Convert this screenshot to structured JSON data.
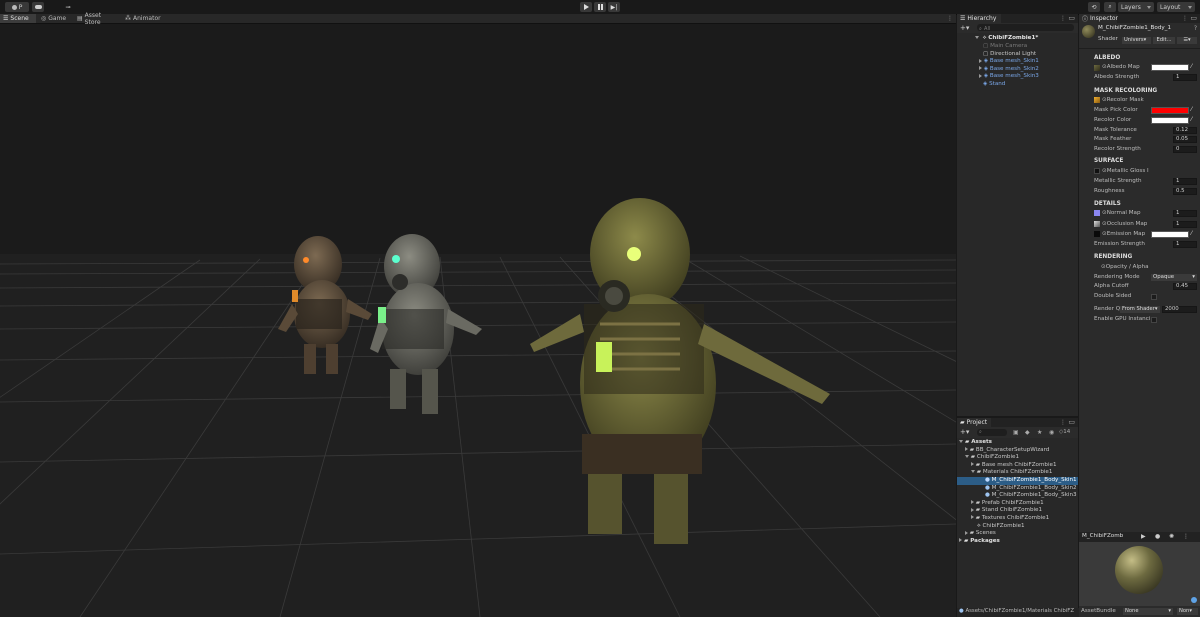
{
  "toolbar": {
    "account_label": "P",
    "layers_label": "Layers",
    "layout_label": "Layout"
  },
  "scene_tabs": [
    "Scene",
    "Game",
    "Asset Store",
    "Animator"
  ],
  "hierarchy": {
    "title": "Hierarchy",
    "search_placeholder": "All",
    "scene_name": "ChibiFZombie1*",
    "items": [
      {
        "label": "Main Camera",
        "style": "grey"
      },
      {
        "label": "Directional Light",
        "style": "normal"
      },
      {
        "label": "Base mesh_Skin1",
        "style": "blue"
      },
      {
        "label": "Base mesh_Skin2",
        "style": "blue"
      },
      {
        "label": "Base mesh_Skin3",
        "style": "blue"
      },
      {
        "label": "Stand",
        "style": "blue"
      }
    ]
  },
  "project": {
    "title": "Project",
    "count_badge": "14",
    "tree": [
      {
        "label": "Assets",
        "indent": 0
      },
      {
        "label": "BB_CharacterSetupWizard",
        "indent": 1
      },
      {
        "label": "ChibiFZombie1",
        "indent": 1
      },
      {
        "label": "Base mesh ChibiFZombie1",
        "indent": 2
      },
      {
        "label": "Materials ChibiFZombie1",
        "indent": 2
      },
      {
        "label": "M_ChibiFZombie1_Body_Skin1",
        "indent": 3,
        "selected": true
      },
      {
        "label": "M_ChibiFZombie1_Body_Skin2",
        "indent": 3
      },
      {
        "label": "M_ChibiFZombie1_Body_Skin3",
        "indent": 3
      },
      {
        "label": "Prefab ChibiFZombie1",
        "indent": 2
      },
      {
        "label": "Stand ChibiFZombie1",
        "indent": 2
      },
      {
        "label": "Textures ChibiFZombie1",
        "indent": 2
      },
      {
        "label": "ChibiFZombie1",
        "indent": 2
      },
      {
        "label": "Scenes",
        "indent": 1
      },
      {
        "label": "Packages",
        "indent": 0
      }
    ],
    "path": "Assets/ChibiFZombie1/Materials ChibiFZ"
  },
  "inspector": {
    "title": "Inspector",
    "material_name": "M_ChibiFZombie1_Body_1",
    "shader_label": "Shader",
    "shader_value": "Univers",
    "edit_label": "Edit...",
    "sections": {
      "albedo": "ALBEDO",
      "mask": "MASK RECOLORING",
      "surface": "SURFACE",
      "details": "DETAILS",
      "rendering": "RENDERING"
    },
    "albedo_map": "Albedo Map",
    "albedo_strength_label": "Albedo Strength",
    "albedo_strength": "1",
    "recolor_mask": "Recolor Mask",
    "mask_pick_color_label": "Mask Pick Color",
    "recolor_color_label": "Recolor Color",
    "mask_tolerance_label": "Mask Tolerance",
    "mask_tolerance": "0.12",
    "mask_feather_label": "Mask Feather",
    "mask_feather": "0.05",
    "recolor_strength_label": "Recolor Strength",
    "recolor_strength": "0",
    "metallic_gloss": "Metallic Gloss I",
    "metallic_strength_label": "Metallic Strength",
    "metallic_strength": "1",
    "roughness_label": "Roughness",
    "roughness": "0.5",
    "normal_map": "Normal Map",
    "normal_value": "1",
    "occlusion_map": "Occlusion Map",
    "occlusion_value": "1",
    "emission_map": "Emission Map",
    "emission_strength_label": "Emission Strength",
    "emission_strength": "1",
    "opacity_alpha": "Opacity / Alpha",
    "rendering_mode_label": "Rendering Mode",
    "rendering_mode": "Opaque",
    "alpha_cutoff_label": "Alpha Cutoff",
    "alpha_cutoff": "0.45",
    "double_sided_label": "Double Sided",
    "render_queue_label": "Render Q",
    "render_queue_mode": "From Shader",
    "render_queue_value": "2000",
    "gpu_instancing_label": "Enable GPU Instanci",
    "preview_title": "M_ChibiFZomb",
    "assetbundle_label": "AssetBundle",
    "assetbundle_value": "None",
    "assetbundle_variant": "Non"
  },
  "colors": {
    "accent": "#2c5d87",
    "mask_pick": "#ff0000",
    "recolor": "#ffffff"
  }
}
